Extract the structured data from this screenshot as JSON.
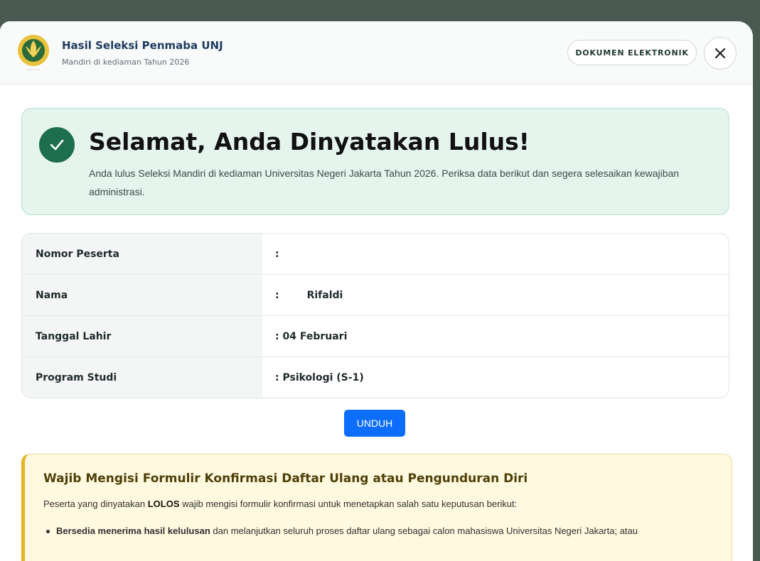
{
  "header": {
    "title": "Hasil Seleksi Penmaba UNJ",
    "subtitle": "Mandiri di kediaman Tahun 2026",
    "doc_button": "DOKUMEN ELEKTRONIK",
    "close_icon": "close-icon",
    "logo_icon": "unj-logo"
  },
  "success": {
    "title": "Selamat, Anda Dinyatakan Lulus!",
    "text": "Anda lulus Seleksi Mandiri di kediaman Universitas Negeri Jakarta Tahun 2026. Periksa data berikut dan segera selesaikan kewajiban administrasi.",
    "icon": "check-icon"
  },
  "info": [
    {
      "label": "Nomor Peserta",
      "value": ":"
    },
    {
      "label": "Nama",
      "value": ":        Rifaldi"
    },
    {
      "label": "Tanggal Lahir",
      "value": ": 04 Februari"
    },
    {
      "label": "Program Studi",
      "value": ": Psikologi (S-1)"
    }
  ],
  "download_button": "UNDUH",
  "notice": {
    "title": "Wajib Mengisi Formulir Konfirmasi Daftar Ulang atau Pengunduran Diri",
    "text_prefix": "Peserta yang dinyatakan ",
    "text_bold": "LOLOS",
    "text_suffix": " wajib mengisi formulir konfirmasi untuk menetapkan salah satu keputusan berikut:",
    "bullet_bold": "Bersedia menerima hasil kelulusan",
    "bullet_rest": " dan melanjutkan seluruh proses daftar ulang sebagai calon mahasiswa Universitas Negeri Jakarta; atau"
  },
  "colors": {
    "accent_green": "#1c6e4c",
    "success_bg": "#e6f4ee",
    "button_blue": "#0d6efd",
    "notice_bg": "#fff9e0",
    "notice_border": "#e4b522"
  }
}
